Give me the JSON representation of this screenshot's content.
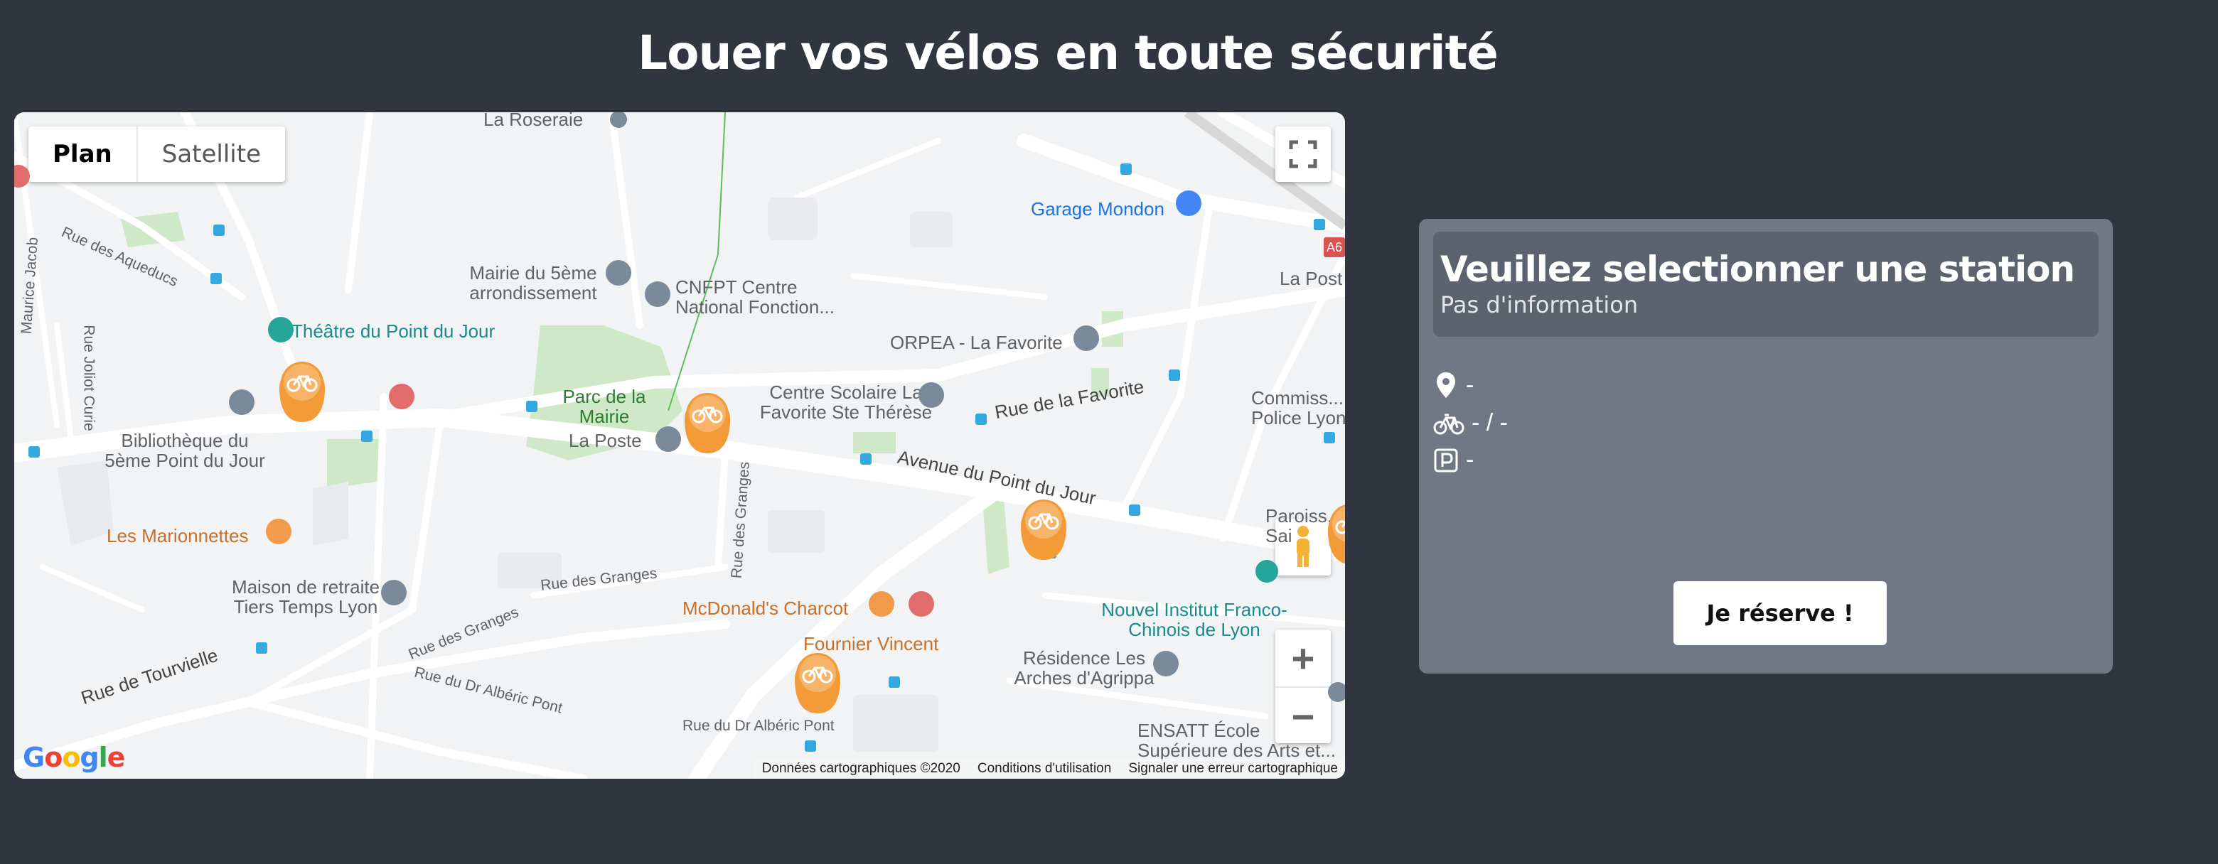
{
  "page": {
    "title": "Louer vos vélos en toute sécurité"
  },
  "map": {
    "map_types": [
      "Plan",
      "Satellite"
    ],
    "attribution": [
      "Données cartographiques ©2020",
      "Conditions d'utilisation",
      "Signaler une erreur cartographique"
    ],
    "logo": "Google",
    "zoom_in": "+",
    "zoom_out": "−",
    "places": {
      "la_roseraie": "La Roseraie",
      "garage_mondon": "Garage Mondon",
      "mairie": "Mairie du 5ème arrondissement",
      "cnfpt": "CNFPT Centre National Fonction...",
      "theatre": "Théâtre du Point du Jour",
      "orpea": "ORPEA - La Favorite",
      "parc": "Parc de la Mairie",
      "centre_scolaire": "Centre Scolaire La Favorite Ste Thérèse",
      "bibliotheque": "Bibliothèque du 5ème Point du Jour",
      "la_poste": "La Poste",
      "marionnettes": "Les Marionnettes",
      "maison_retraite": "Maison de retraite Tiers Temps Lyon",
      "mcdonalds": "McDonald's Charcot",
      "fournier": "Fournier Vincent",
      "nouvel_institut": "Nouvel Institut Franco-Chinois de Lyon",
      "residence": "Résidence Les Arches d'Agrippa",
      "ensatt": "ENSATT École Supérieure des Arts et...",
      "commissariat": "Commiss... Police Lyon",
      "la_poste_2": "La Post",
      "paroisse": "Paroiss... Sai"
    },
    "roads": {
      "aqueducs": "Rue des Aqueducs",
      "joliot_curie": "Rue Joliot Curie",
      "favorite": "Rue de la Favorite",
      "avenue_point_du_jour": "Avenue du Point du Jour",
      "granges_v": "Rue des Granges",
      "granges_1": "Rue des Granges",
      "granges_2": "Rue des Granges",
      "tourvielle": "Rue de Tourvielle",
      "alberic_1": "Rue du Dr Albéric Pont",
      "alberic_2": "Rue du Dr Albéric Pont",
      "maurice_jacob": "Maurice Jacob",
      "a6": "A6"
    }
  },
  "panel": {
    "title": "Veuillez selectionner une station",
    "subtitle": "Pas d'information",
    "address": "-",
    "bikes": "- / -",
    "parking": "-",
    "reserve_label": "Je réserve !"
  },
  "colors": {
    "background": "#31353f",
    "panel": "#717784",
    "panel_header": "#5d626f",
    "marker": "#f29b38"
  }
}
